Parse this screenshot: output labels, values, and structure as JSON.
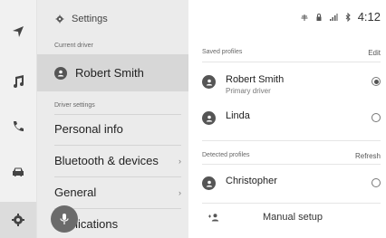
{
  "rail": {
    "items": [
      {
        "icon": "navigation-arrow-icon"
      },
      {
        "icon": "music-note-icon"
      },
      {
        "icon": "phone-icon"
      },
      {
        "icon": "car-icon"
      },
      {
        "icon": "gear-icon",
        "active": true
      }
    ]
  },
  "menu": {
    "title": "Settings",
    "current_driver_label": "Current driver",
    "current_driver_name": "Robert Smith",
    "driver_settings_label": "Driver settings",
    "items": [
      {
        "label": "Personal info",
        "chevron": false
      },
      {
        "label": "Bluetooth & devices",
        "chevron": true
      },
      {
        "label": "General",
        "chevron": true
      },
      {
        "label": "Applications",
        "chevron": false
      }
    ]
  },
  "status": {
    "time": "4:12",
    "icons": [
      "antenna-icon",
      "lock-icon",
      "signal-icon",
      "bluetooth-icon"
    ]
  },
  "panel": {
    "saved_label": "Saved profiles",
    "edit_label": "Edit",
    "saved_profiles": [
      {
        "name": "Robert Smith",
        "sub": "Primary driver",
        "selected": true
      },
      {
        "name": "Linda",
        "sub": "",
        "selected": false
      }
    ],
    "detected_label": "Detected profiles",
    "refresh_label": "Refresh",
    "detected_profiles": [
      {
        "name": "Christopher",
        "selected": false
      }
    ],
    "manual_setup_label": "Manual setup"
  },
  "colors": {
    "background": "#ffffff",
    "rail": "#f1f1f1",
    "menu": "#ebebeb",
    "selected_row": "#d7d7d7",
    "avatar": "#555555",
    "mic_button": "#6b6b6b"
  }
}
